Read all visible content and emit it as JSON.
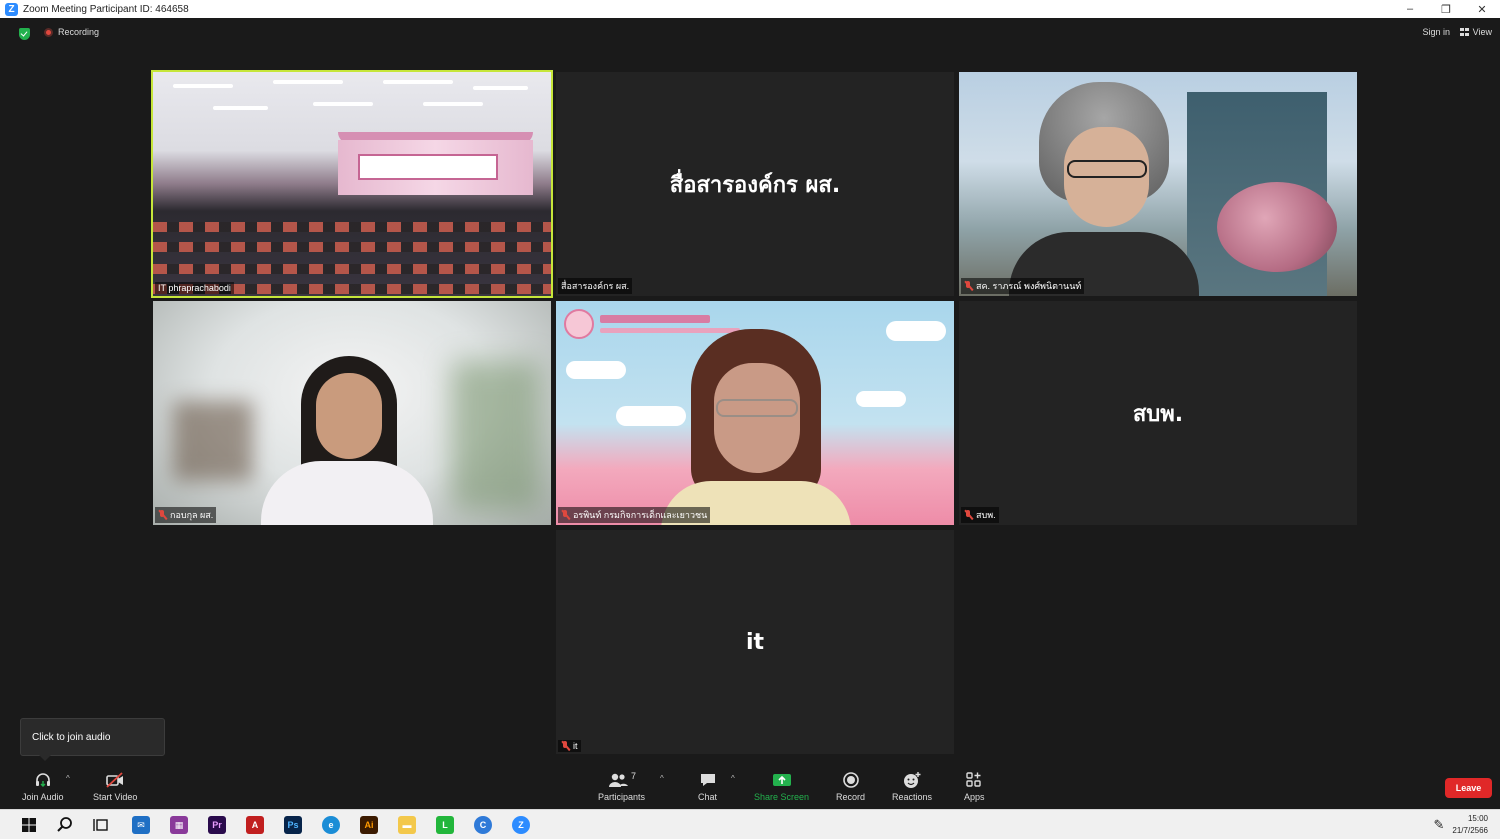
{
  "window": {
    "title": "Zoom Meeting Participant ID: 464658",
    "min": "–",
    "restore": "❐",
    "close": "✕"
  },
  "top": {
    "recording": "Recording",
    "sign_in": "Sign in",
    "view": "View"
  },
  "tiles": [
    {
      "label": "IT phraprachabodi",
      "muted": false,
      "active": true
    },
    {
      "label": "สื่อสารองค์กร ผส.",
      "center_name": "สื่อสารองค์กร ผส.",
      "muted": false
    },
    {
      "label": "สค. ราภรณ์ พงศ์พนิตานนท์",
      "muted": true
    },
    {
      "label": "กอบกุล ผส.",
      "muted": true
    },
    {
      "label": "อรพินท์ กรมกิจการเด็กและเยาวชน",
      "muted": true
    },
    {
      "label": "สบพ.",
      "center_name": "สบพ.",
      "muted": true
    },
    {
      "label": "it",
      "center_name": "it",
      "muted": true
    }
  ],
  "tooltip": "Click to join audio",
  "toolbar": {
    "join_audio": "Join Audio",
    "start_video": "Start Video",
    "participants": "Participants",
    "participant_count": "7",
    "chat": "Chat",
    "share_screen": "Share Screen",
    "record": "Record",
    "reactions": "Reactions",
    "apps": "Apps",
    "leave": "Leave"
  },
  "taskbar": {
    "time": "15:00",
    "date": "21/7/2566",
    "apps": [
      "windows-start",
      "search",
      "task-view",
      "mail",
      "winrar",
      "premiere-pro",
      "acrobat",
      "photoshop",
      "edge",
      "illustrator",
      "file-explorer",
      "line",
      "browser",
      "zoom"
    ]
  },
  "colors": {
    "active_speaker": "#c6e63a",
    "leave": "#e02828",
    "share": "#23b14d",
    "recording": "#e0483e"
  }
}
